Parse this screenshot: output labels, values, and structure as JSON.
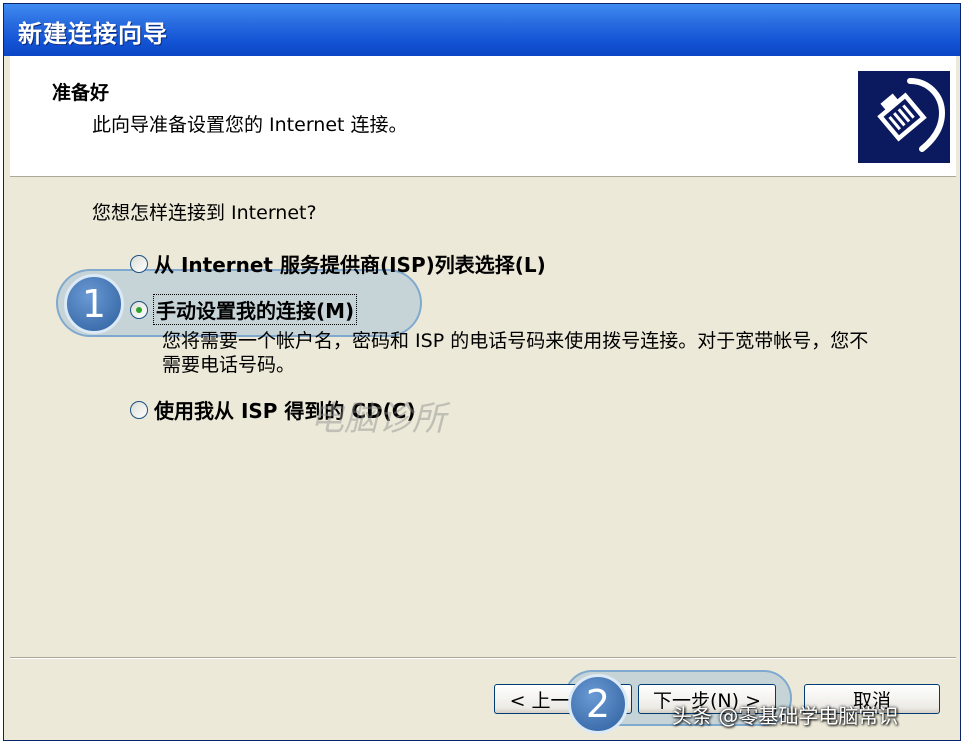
{
  "window": {
    "title": "新建连接向导"
  },
  "header": {
    "title": "准备好",
    "description": "此向导准备设置您的 Internet 连接。",
    "icon": "network-cable-icon"
  },
  "main": {
    "question": "您想怎样连接到 Internet?",
    "options": [
      {
        "label": "从 Internet 服务提供商(ISP)列表选择(L)",
        "checked": false
      },
      {
        "label": "手动设置我的连接(M)",
        "checked": true
      },
      {
        "label": "使用我从 ISP 得到的 CD(C)",
        "checked": false
      }
    ],
    "option2_description": "您将需要一个帐户名，密码和 ISP 的电话号码来使用拨号连接。对于宽带帐号，您不需要电话号码。"
  },
  "buttons": {
    "back": "< 上一步(B)",
    "next": "下一步(N) >",
    "cancel": "取消"
  },
  "annotations": {
    "badge1": "1",
    "badge2": "2",
    "watermark": "电脑诊所",
    "footer_watermark": "头条 @零基础学电脑常识"
  },
  "colors": {
    "titlebar": "#1455d6",
    "header_icon_bg": "#0b1a5e",
    "dialog_bg": "#ece9d8",
    "radio_dot": "#2ba42b"
  }
}
